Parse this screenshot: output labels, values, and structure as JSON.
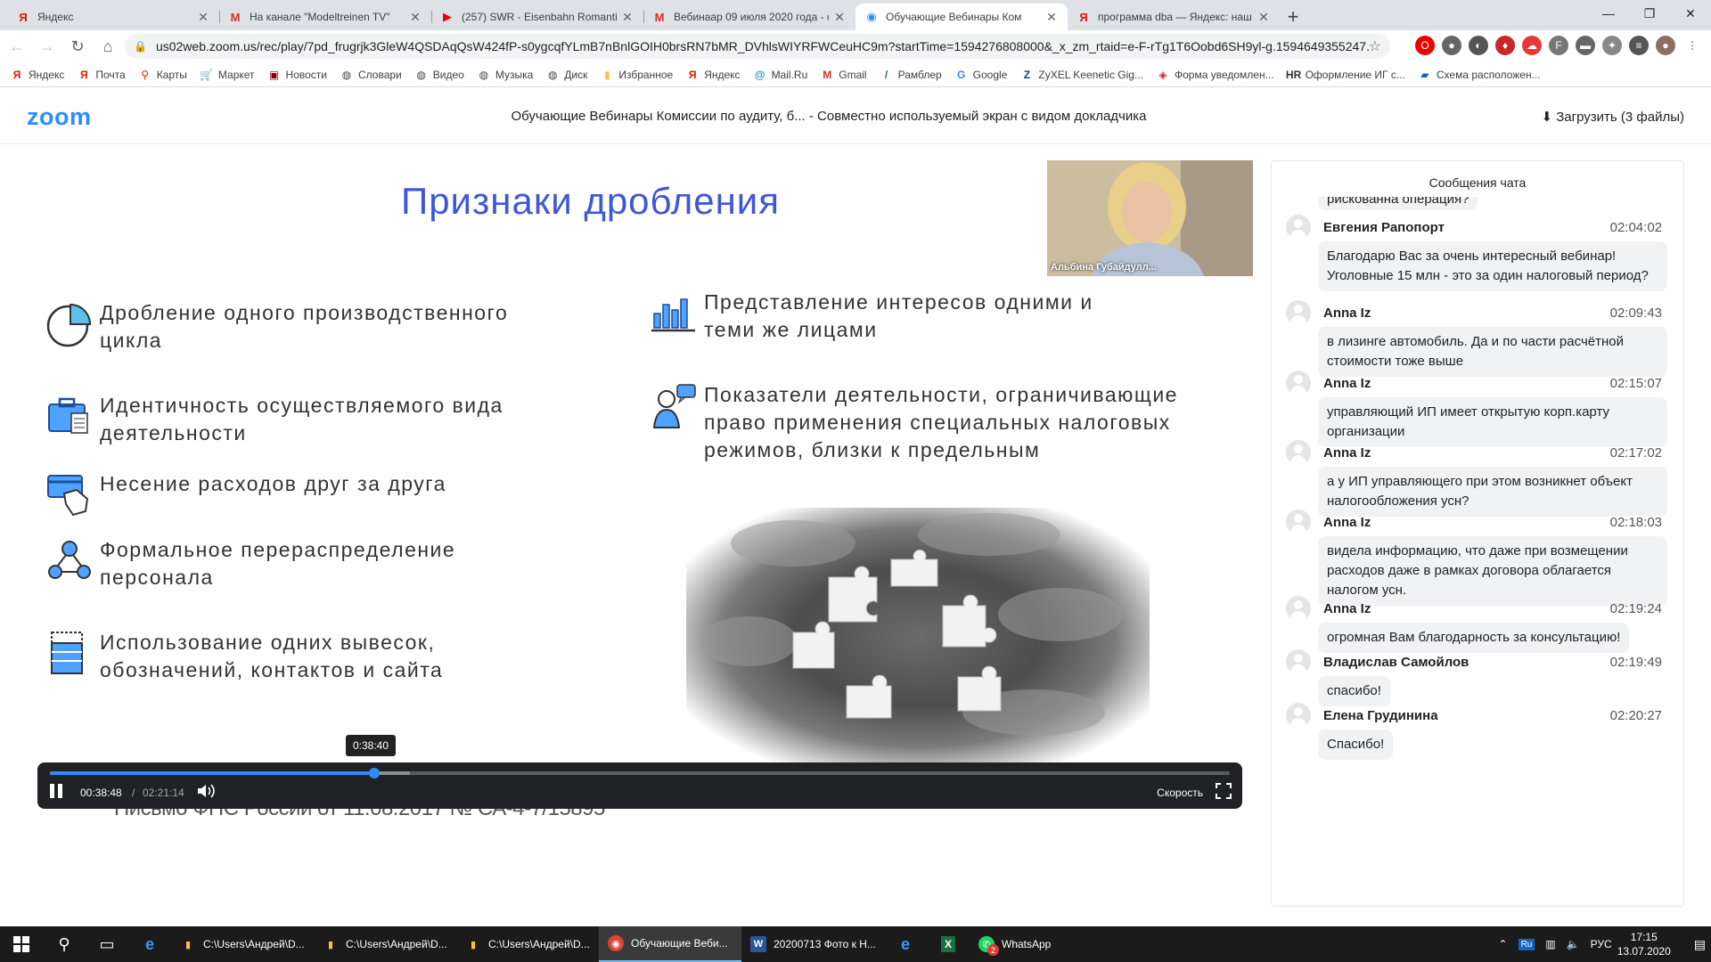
{
  "browser": {
    "tabs": [
      {
        "title": "Яндекс",
        "icon": "yandex-icon",
        "active": false
      },
      {
        "title": "На канале \"Modeltreinen TV\"",
        "icon": "gmail-icon",
        "active": false
      },
      {
        "title": "(257) SWR - Eisenbahn Romantik",
        "icon": "youtube-icon",
        "active": false
      },
      {
        "title": "Вебинаар 09 июля 2020 года - о",
        "icon": "gmail-icon",
        "active": false
      },
      {
        "title": "Обучающие Вебинары Ком",
        "icon": "zoom-icon",
        "active": true
      },
      {
        "title": "программа dba — Яндекс: наш",
        "icon": "yandex-icon",
        "active": false
      }
    ],
    "url": "us02web.zoom.us/rec/play/7pd_frugrjk3GleW4QSDAqQsW424fP-s0ygcqfYLmB7nBnlGOIH0brsRN7bMR_DVhlsWIYRFWCeuHC9m?startTime=1594276808000&_x_zm_rtaid=e-F-rTg1T6Oobd6SH9yl-g.1594649355247.8e7c78...",
    "bookmarks": [
      {
        "label": "Яндекс",
        "icon": "yandex-icon",
        "color": "#e61400"
      },
      {
        "label": "Почта",
        "icon": "yandex-mail-icon",
        "color": "#e61400"
      },
      {
        "label": "Карты",
        "icon": "map-pin-icon",
        "color": "#e61400"
      },
      {
        "label": "Маркет",
        "icon": "cart-icon",
        "color": "#1a237e"
      },
      {
        "label": "Новости",
        "icon": "news-icon",
        "color": "#8b0000"
      },
      {
        "label": "Словари",
        "icon": "globe-icon",
        "color": "#444"
      },
      {
        "label": "Видео",
        "icon": "globe-icon",
        "color": "#444"
      },
      {
        "label": "Музыка",
        "icon": "globe-icon",
        "color": "#444"
      },
      {
        "label": "Диск",
        "icon": "globe-icon",
        "color": "#444"
      },
      {
        "label": "Избранное",
        "icon": "folder-icon",
        "color": "#f4c542"
      },
      {
        "label": "Яндекс",
        "icon": "yandex-icon",
        "color": "#e61400"
      },
      {
        "label": "Mail.Ru",
        "icon": "at-icon",
        "color": "#168de2"
      },
      {
        "label": "Gmail",
        "icon": "gmail-icon",
        "color": "#d93025"
      },
      {
        "label": "Рамблер",
        "icon": "rambler-icon",
        "color": "#3155e0"
      },
      {
        "label": "Google",
        "icon": "google-icon",
        "color": "#4285f4"
      },
      {
        "label": "ZyXEL Keenetic Gig...",
        "icon": "zyxel-icon",
        "color": "#123b7a"
      },
      {
        "label": "Форма уведомлен...",
        "icon": "form-icon",
        "color": "#c62828"
      },
      {
        "label": "Оформление ИГ с...",
        "icon": "hr-icon",
        "color": "#333"
      },
      {
        "label": "Схема расположен...",
        "icon": "flag-icon",
        "color": "#1565c0"
      }
    ]
  },
  "zoom": {
    "logo": "zoom",
    "meeting_title": "Обучающие Вебинары Комиссии по аудиту, б...  - Совместно используемый экран с видом докладчика",
    "download": "Загрузить (3 файлы)",
    "slide": {
      "title": "Признаки дробления",
      "bullets_left": [
        {
          "text": "Дробление одного производственного цикла",
          "icon": "pie-chart-icon"
        },
        {
          "text": "Идентичность осуществляемого вида деятельности",
          "icon": "briefcase-icon"
        },
        {
          "text": "Несение расходов друг за друга",
          "icon": "card-payment-icon"
        },
        {
          "text": "Формальное перераспределение персонала",
          "icon": "people-network-icon"
        },
        {
          "text": "Использование одних вывесок, обозначений, контактов и сайта",
          "icon": "storefront-icon"
        }
      ],
      "bullets_right": [
        {
          "text": "Представление интересов одними и теми же лицами",
          "icon": "bar-chart-icon"
        },
        {
          "text": "Показатели деятельности, ограничивающие право применения специальных налоговых режимов, близки к предельным",
          "icon": "person-speech-icon"
        }
      ],
      "letter_ref": "Письмо ФНС России от 11.08.2017 № СА-4-7/15895"
    },
    "speaker": "Альбина Губайдулл...",
    "player": {
      "tooltip": "0:38:40",
      "current": "00:38:48",
      "separator": "/",
      "total": "02:21:14",
      "progress": 0.2748,
      "buffered": 0.3051,
      "speed_label": "Скорость"
    },
    "chat": {
      "title": "Сообщения чата",
      "partial_top": "рискованна операция?",
      "messages": [
        {
          "name": "Евгения Рапопорт",
          "time": "02:04:02",
          "text": "Благодарю Вас за очень интересный вебинар! Уголовные 15 млн - это за один налоговый период?"
        },
        {
          "name": "Anna Iz",
          "time": "02:09:43",
          "text": "в лизинге автомобиль. Да и по части расчётной стоимости тоже выше"
        },
        {
          "name": "Anna Iz",
          "time": "02:15:07",
          "text": "управляющий ИП имеет открытую корп.карту организации"
        },
        {
          "name": "Anna Iz",
          "time": "02:17:02",
          "text": "а у ИП управляющего при этом возникнет объект налогообложения усн?"
        },
        {
          "name": "Anna Iz",
          "time": "02:18:03",
          "text": "видела информацию, что даже при возмещении расходов даже в рамках договора облагается налогом усн."
        },
        {
          "name": "Anna Iz",
          "time": "02:19:24",
          "text": "огромная Вам благодарность за консультацию!"
        },
        {
          "name": "Владислав Самойлов",
          "time": "02:19:49",
          "text": "спасибо!"
        },
        {
          "name": "Елена Грудинина",
          "time": "02:20:27",
          "text": "Спасибо!"
        }
      ]
    }
  },
  "taskbar": {
    "apps": [
      {
        "label": "C:\\Users\\Андрей\\D...",
        "icon": "folder-icon",
        "active": false
      },
      {
        "label": "C:\\Users\\Андрей\\D...",
        "icon": "folder-icon",
        "active": false
      },
      {
        "label": "C:\\Users\\Андрей\\D...",
        "icon": "folder-icon",
        "active": false
      },
      {
        "label": "Обучающие Веби...",
        "icon": "chrome-icon",
        "active": true
      },
      {
        "label": "20200713 Фото к Н...",
        "icon": "word-icon",
        "active": false
      }
    ],
    "whatsapp_label": "WhatsApp",
    "whatsapp_badge": "2",
    "tray_lang_badge": "Ru",
    "lang": "РУС",
    "time": "17:15",
    "date": "13.07.2020"
  }
}
